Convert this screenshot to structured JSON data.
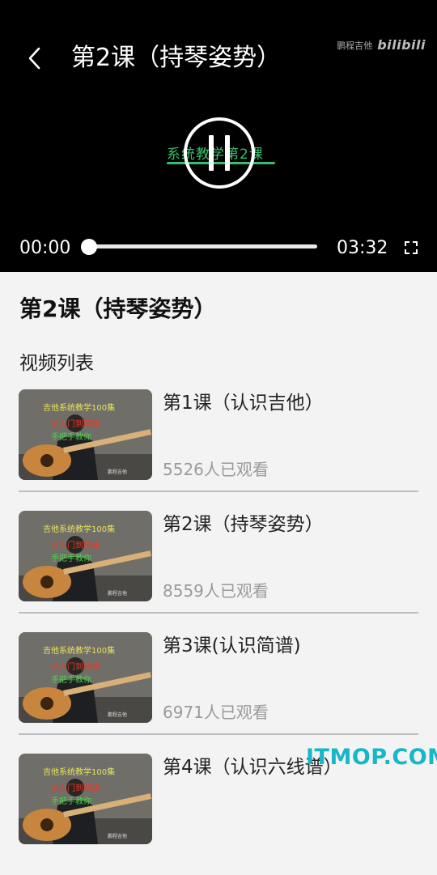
{
  "player": {
    "title": "第2课（持琴姿势）",
    "watermark_text": "鹏程吉他",
    "watermark_logo": "bilibili",
    "caption": "系统教学第2课",
    "current_time": "00:00",
    "total_time": "03:32",
    "progress": 0
  },
  "content": {
    "title": "第2课（持琴姿势）",
    "section_label": "视频列表"
  },
  "thumbnail": {
    "line1": "吉他系统教学100集",
    "line2": "从入门到精通",
    "line3": "手把手教你",
    "footer": "鹏程吉他"
  },
  "videos": [
    {
      "title": "第1课（认识吉他）",
      "views": "5526人已观看"
    },
    {
      "title": "第2课（持琴姿势）",
      "views": "8559人已观看"
    },
    {
      "title": "第3课(认识简谱)",
      "views": "6971人已观看"
    },
    {
      "title": "第4课（认识六线谱）",
      "views": ""
    }
  ],
  "site_watermark": "ITMOP.COM"
}
